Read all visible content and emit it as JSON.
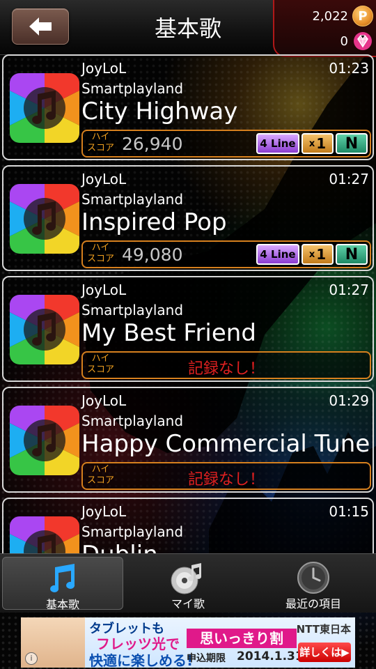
{
  "header": {
    "title": "基本歌",
    "coins": "2,022",
    "gems": "0",
    "coin_symbol": "P"
  },
  "songs": [
    {
      "artist": "JoyLoL",
      "label": "Smartplayland",
      "title": "City Highway",
      "duration": "01:23",
      "score_label_top": "ハイ",
      "score_label_bottom": "スコア",
      "score": "26,940",
      "lines": "4 Line",
      "mult_prefix": "x",
      "mult": "1",
      "difficulty": "N"
    },
    {
      "artist": "JoyLoL",
      "label": "Smartplayland",
      "title": "Inspired Pop",
      "duration": "01:27",
      "score_label_top": "ハイ",
      "score_label_bottom": "スコア",
      "score": "49,080",
      "lines": "4 Line",
      "mult_prefix": "x",
      "mult": "1",
      "difficulty": "N"
    },
    {
      "artist": "JoyLoL",
      "label": "Smartplayland",
      "title": "My Best Friend",
      "duration": "01:27",
      "score_label_top": "ハイ",
      "score_label_bottom": "スコア",
      "no_record": "記録なし！"
    },
    {
      "artist": "JoyLoL",
      "label": "Smartplayland",
      "title": "Happy Commercial Tune",
      "duration": "01:29",
      "score_label_top": "ハイ",
      "score_label_bottom": "スコア",
      "no_record": "記録なし！"
    },
    {
      "artist": "JoyLoL",
      "label": "Smartplayland",
      "title": "Dublin",
      "duration": "01:15"
    }
  ],
  "nav": {
    "basic": "基本歌",
    "my": "マイ歌",
    "recent": "最近の項目"
  },
  "ad": {
    "line1": "タブレットも",
    "line2": "フレッツ光で",
    "line3": "快適に楽しめる!",
    "campaign": "思いっきり割",
    "deadline_label": "申込期限",
    "deadline": "2014.1.31",
    "brand": "NTT東日本",
    "cta": "詳しくは▶",
    "info": "i"
  },
  "colors": {
    "accent_red": "#b01818",
    "score_border": "#d6801e",
    "no_record": "#e02020"
  }
}
